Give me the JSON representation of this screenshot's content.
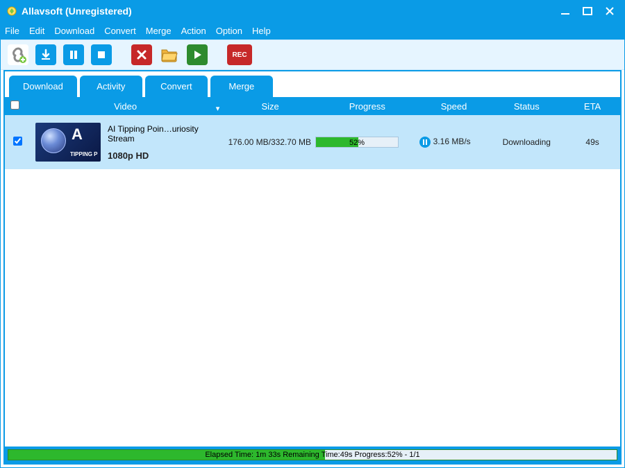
{
  "window": {
    "title": "Allavsoft (Unregistered)"
  },
  "menu": {
    "items": [
      "File",
      "Edit",
      "Download",
      "Convert",
      "Merge",
      "Action",
      "Option",
      "Help"
    ]
  },
  "tabs": {
    "items": [
      "Download",
      "Activity",
      "Convert",
      "Merge"
    ]
  },
  "columns": {
    "video": "Video",
    "size": "Size",
    "progress": "Progress",
    "speed": "Speed",
    "status": "Status",
    "eta": "ETA"
  },
  "rows": [
    {
      "title": "AI Tipping Poin…uriosity Stream",
      "resolution": "1080p HD",
      "size": "176.00 MB/332.70 MB",
      "progress_pct": "52%",
      "speed": "3.16 MB/s",
      "status": "Downloading",
      "eta": "49s"
    }
  ],
  "footer": {
    "text": "Elapsed Time: 1m 33s Remaining Time:49s Progress:52% - 1/1",
    "fill_pct": 52
  }
}
